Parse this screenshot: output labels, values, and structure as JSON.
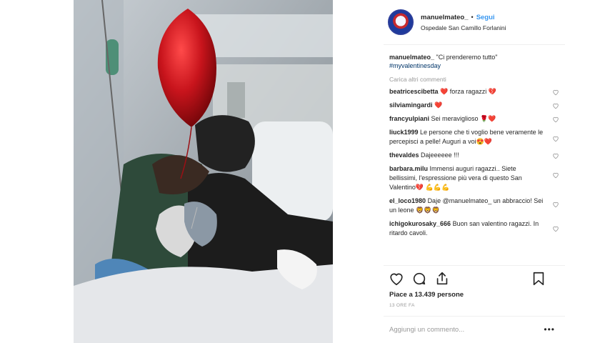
{
  "post": {
    "username": "manuelmateo_",
    "separator": "•",
    "follow_label": "Segui",
    "location": "Ospedale San Camillo Forlanini"
  },
  "caption": {
    "username": "manuelmateo_",
    "text": "\"Ci prenderemo tutto\"",
    "hashtag": "#myvalentinesday"
  },
  "load_more_label": "Carica altri commenti",
  "comments": [
    {
      "user": "beatricescibetta",
      "text": "❤️ forza ragazzi 💔"
    },
    {
      "user": "silviamingardi",
      "text": "❤️"
    },
    {
      "user": "francyulpiani",
      "text": "Sei meraviglioso 🌹❤️"
    },
    {
      "user": "liuck1999",
      "text": "Le persone che ti voglio bene veramente le percepisci a pelle! Auguri a voi😍❤️"
    },
    {
      "user": "thevaldes",
      "text": "Dajeeeeee !!!"
    },
    {
      "user": "barbara.milu",
      "text": "Immensi auguri ragazzi.. Siete bellissimi, l'espressione più vera di questo San Valentino💔 💪💪💪"
    },
    {
      "user": "el_loco1980",
      "text": "Daje @manuelmateo_ un abbraccio! Sei un leone 🦁🦁🦁"
    },
    {
      "user": "ichigokurosaky_666",
      "text": "Buon san valentino ragazzi. In ritardo cavoli."
    }
  ],
  "likes_label": "Piace a 13.439 persone",
  "time_label": "13 ORE FA",
  "add_comment_placeholder": "Aggiungi un commento...",
  "more_label": "•••",
  "icons": {
    "like": "heart-icon",
    "comment": "comment-bubble-icon",
    "share": "share-icon",
    "save": "bookmark-icon"
  },
  "colors": {
    "link": "#3897f0",
    "hashtag": "#003569",
    "muted": "#999999",
    "text": "#262626",
    "balloon": "#c8141c"
  }
}
